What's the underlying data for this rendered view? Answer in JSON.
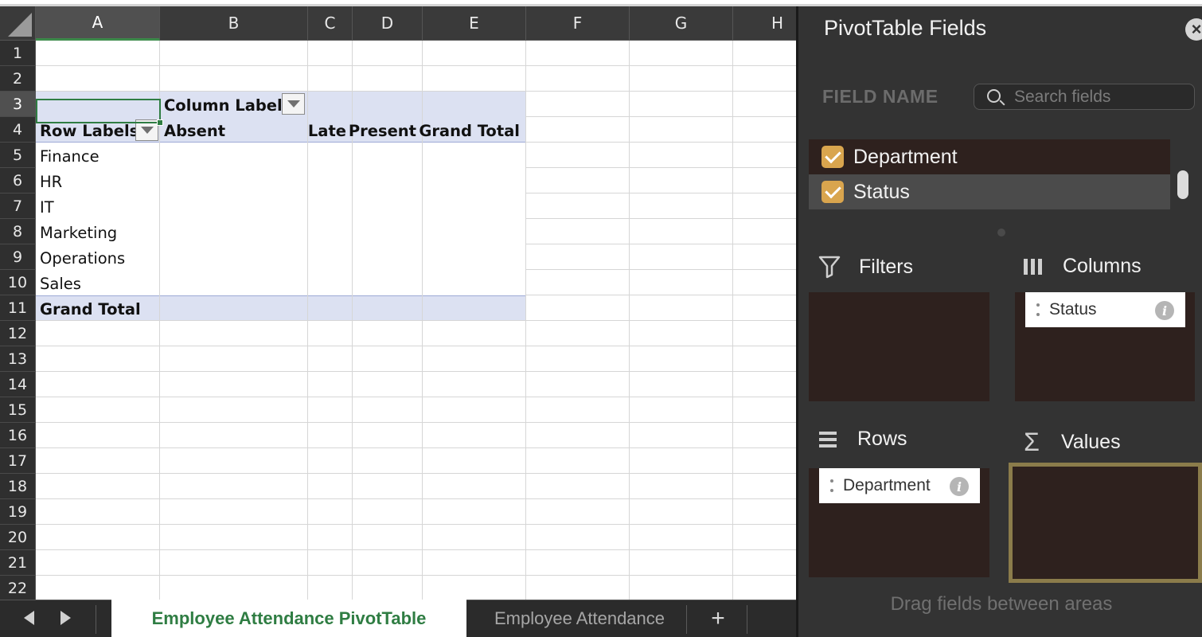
{
  "sheet": {
    "columns": [
      "A",
      "B",
      "C",
      "D",
      "E",
      "F",
      "G",
      "H"
    ],
    "rows": [
      "1",
      "2",
      "3",
      "4",
      "5",
      "6",
      "7",
      "8",
      "9",
      "10",
      "11",
      "12",
      "13",
      "14",
      "15",
      "16",
      "17",
      "18",
      "19",
      "20",
      "21",
      "22"
    ],
    "pivot": {
      "column_labels": "Column Labels",
      "row_labels": "Row Labels",
      "headers": [
        "Absent",
        "Late",
        "Present",
        "Grand Total"
      ],
      "items": [
        "Finance",
        "HR",
        "IT",
        "Marketing",
        "Operations",
        "Sales"
      ],
      "grand_total": "Grand Total"
    },
    "tabs": {
      "active": "Employee Attendance PivotTable",
      "inactive": "Employee Attendance",
      "add": "+"
    }
  },
  "pane": {
    "title": "PivotTable Fields",
    "close": "×",
    "field_name_label": "FIELD NAME",
    "search_placeholder": "Search fields",
    "fields": [
      {
        "label": "Department",
        "checked": true
      },
      {
        "label": "Status",
        "checked": true
      }
    ],
    "areas": {
      "filters": {
        "label": "Filters"
      },
      "columns": {
        "label": "Columns",
        "items": [
          "Status"
        ]
      },
      "rows": {
        "label": "Rows",
        "items": [
          "Department"
        ]
      },
      "values": {
        "label": "Values"
      }
    },
    "info": "i",
    "drag_hint": "Drag fields between areas"
  },
  "colors": {
    "accent": "#2f7d43",
    "pivot_band": "#dce1f2",
    "checkbox": "#d9a54e",
    "area_bg": "#2e211e",
    "values_highlight": "#8b7c4b"
  }
}
